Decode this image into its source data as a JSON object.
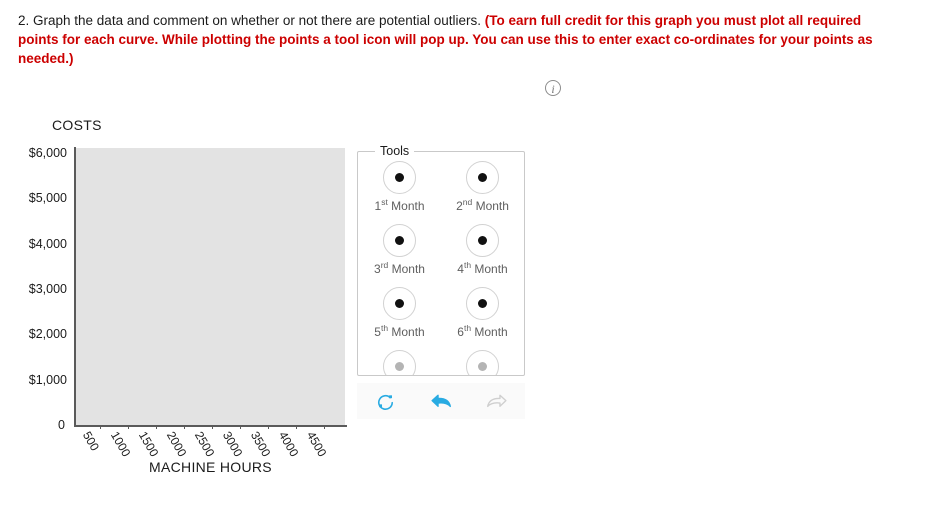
{
  "prompt": {
    "lead": "2. Graph the data and comment on whether or not there are potential outliers.",
    "emphasis": "(To earn full credit for this graph you must plot all required points for each curve. While plotting the points a tool icon will pop up. You can use this to enter exact co-ordinates for your points as needed.)"
  },
  "info_icon": {
    "glyph": "i",
    "name": "info-icon"
  },
  "chart_data": {
    "type": "scatter",
    "title": "COSTS",
    "ylabel": "COSTS",
    "xlabel": "MACHINE HOURS",
    "x": [],
    "values": [],
    "series": [],
    "xticks": [
      "500",
      "1000",
      "1500",
      "2000",
      "2500",
      "3000",
      "3500",
      "4000",
      "4500"
    ],
    "yticks": [
      "$6,000",
      "$5,000",
      "$4,000",
      "$3,000",
      "$2,000",
      "$1,000",
      "0"
    ],
    "ylim": [
      0,
      6500
    ],
    "xlim": [
      0,
      4750
    ],
    "grid": false,
    "legend": "none",
    "plot_background": "#e3e3e3",
    "note": "Empty plotting canvas - no data points have been plotted yet"
  },
  "tools": {
    "legend": "Tools",
    "items": [
      {
        "ordinal": "1",
        "suffix": "st",
        "label": " Month",
        "faded": false
      },
      {
        "ordinal": "2",
        "suffix": "nd",
        "label": " Month",
        "faded": false
      },
      {
        "ordinal": "3",
        "suffix": "rd",
        "label": " Month",
        "faded": false
      },
      {
        "ordinal": "4",
        "suffix": "th",
        "label": " Month",
        "faded": false
      },
      {
        "ordinal": "5",
        "suffix": "th",
        "label": " Month",
        "faded": false
      },
      {
        "ordinal": "6",
        "suffix": "th",
        "label": " Month",
        "faded": false
      },
      {
        "ordinal": "",
        "suffix": "",
        "label": "",
        "faded": true
      },
      {
        "ordinal": "",
        "suffix": "",
        "label": "",
        "faded": true
      }
    ]
  },
  "toolbar": {
    "reset_name": "reset-icon",
    "undo_name": "undo-icon",
    "redo_name": "redo-icon",
    "active_color": "#29abe2",
    "disabled_color": "#cfcfcf"
  }
}
